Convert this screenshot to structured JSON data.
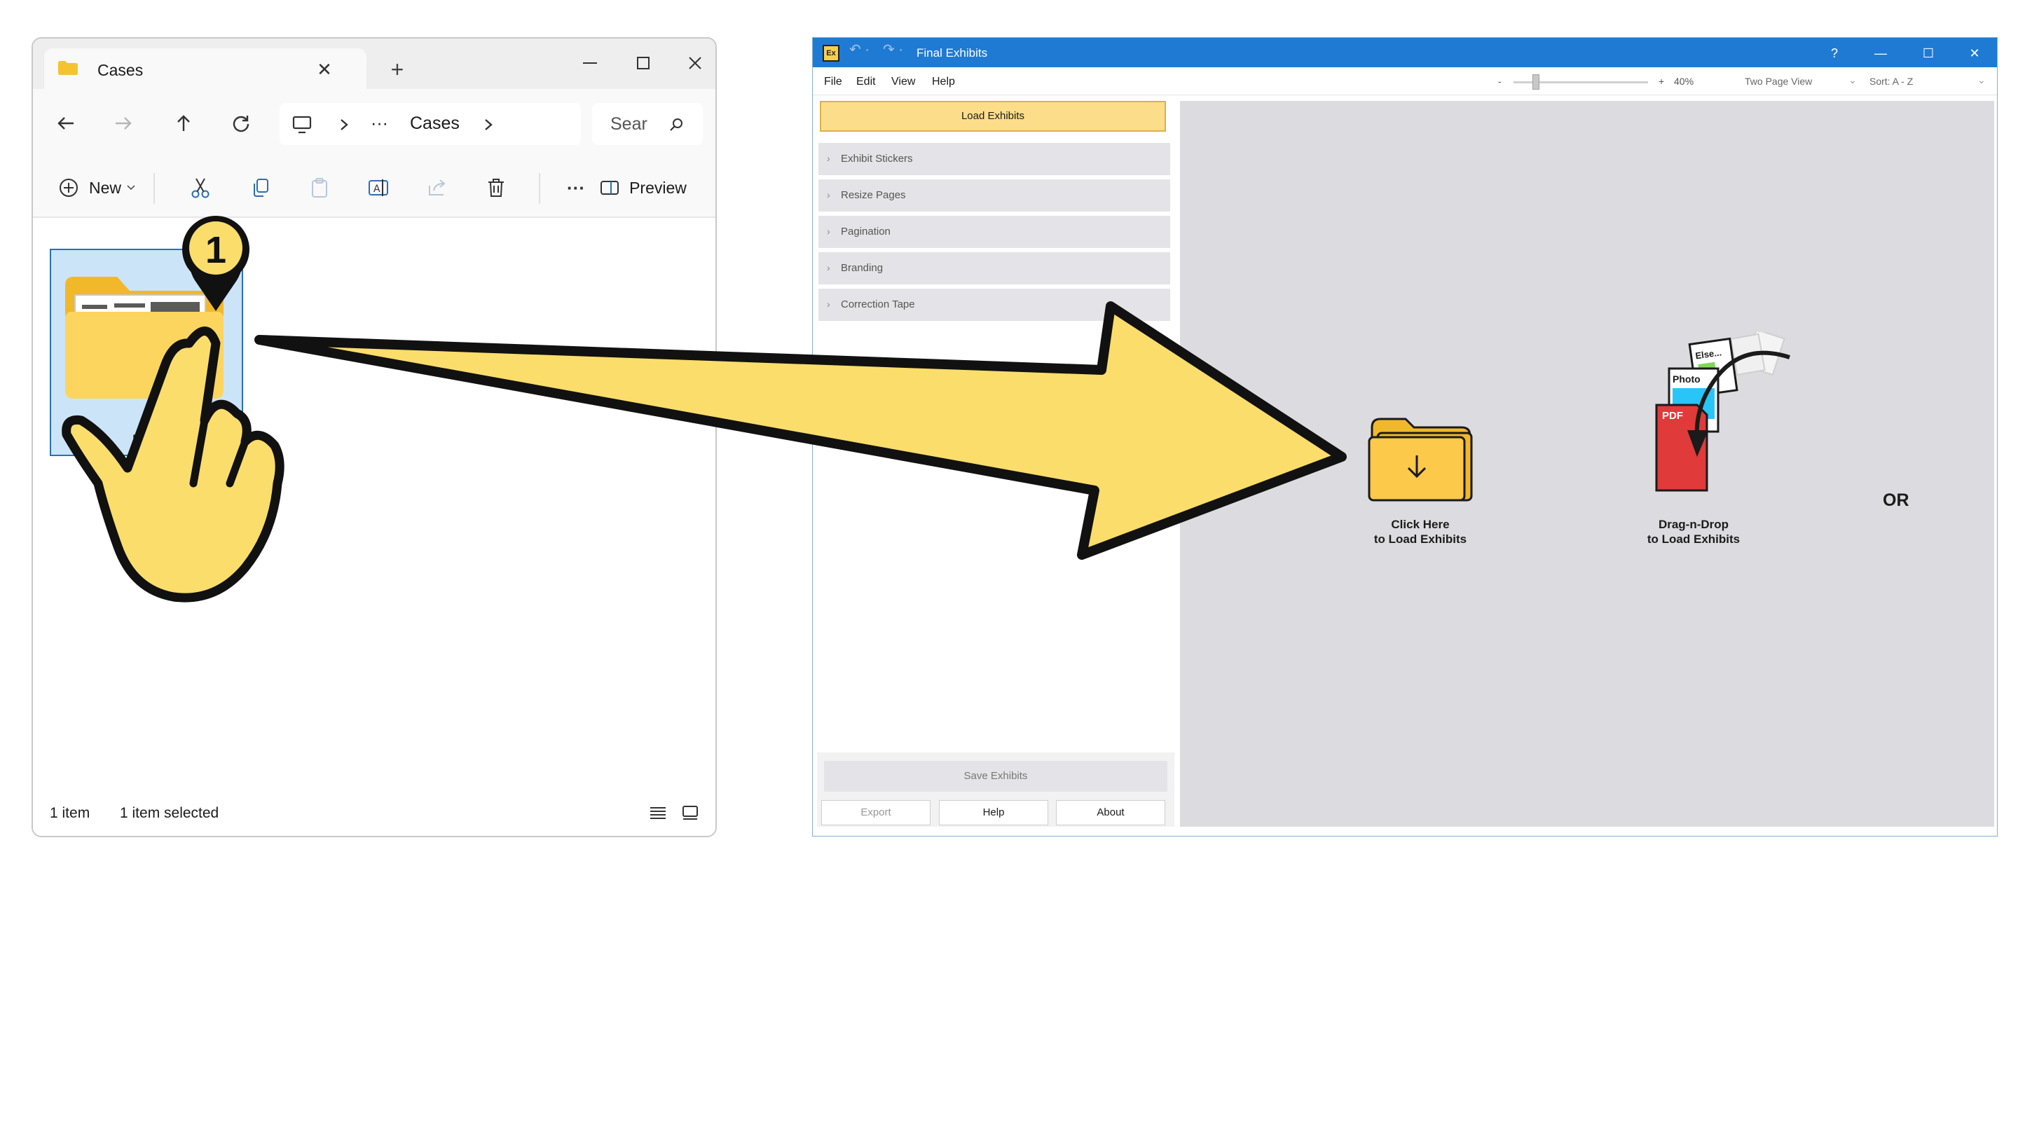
{
  "explorer": {
    "tab_title": "Cases",
    "breadcrumb_ellipsis": "···",
    "breadcrumb_current": "Cases",
    "search_placeholder": "Sear",
    "toolbar": {
      "new_label": "New",
      "more_label": "···",
      "preview_label": "Preview"
    },
    "item": {
      "label": "Exhi"
    },
    "status": {
      "count": "1 item",
      "selected": "1 item selected"
    }
  },
  "final_exhibits": {
    "title": "Final Exhibits",
    "logo": "Ex",
    "title_buttons": {
      "help": "?"
    },
    "menu": [
      "File",
      "Edit",
      "View",
      "Help"
    ],
    "zoom": {
      "minus": "-",
      "plus": "+",
      "value": "40%",
      "level_fraction": 0.18
    },
    "view_mode": "Two Page View",
    "sort": "Sort: A - Z",
    "load_button": "Load Exhibits",
    "sections": [
      "Exhibit Stickers",
      "Resize Pages",
      "Pagination",
      "Branding",
      "Correction Tape"
    ],
    "save_button": "Save Exhibits",
    "bottom_buttons": {
      "export": "Export",
      "help": "Help",
      "about": "About"
    },
    "drop": {
      "click_caption_line1": "Click Here",
      "click_caption_line2": "to Load Exhibits",
      "or_text": "OR",
      "drag_caption_line1": "Drag-n-Drop",
      "drag_caption_line2": "to Load Exhibits",
      "file_labels": {
        "pdf": "PDF",
        "photo": "Photo",
        "else": "Else..."
      }
    }
  },
  "annotation": {
    "step_number": "1",
    "accent_color": "#fbdd6b",
    "outline_color": "#111111"
  }
}
